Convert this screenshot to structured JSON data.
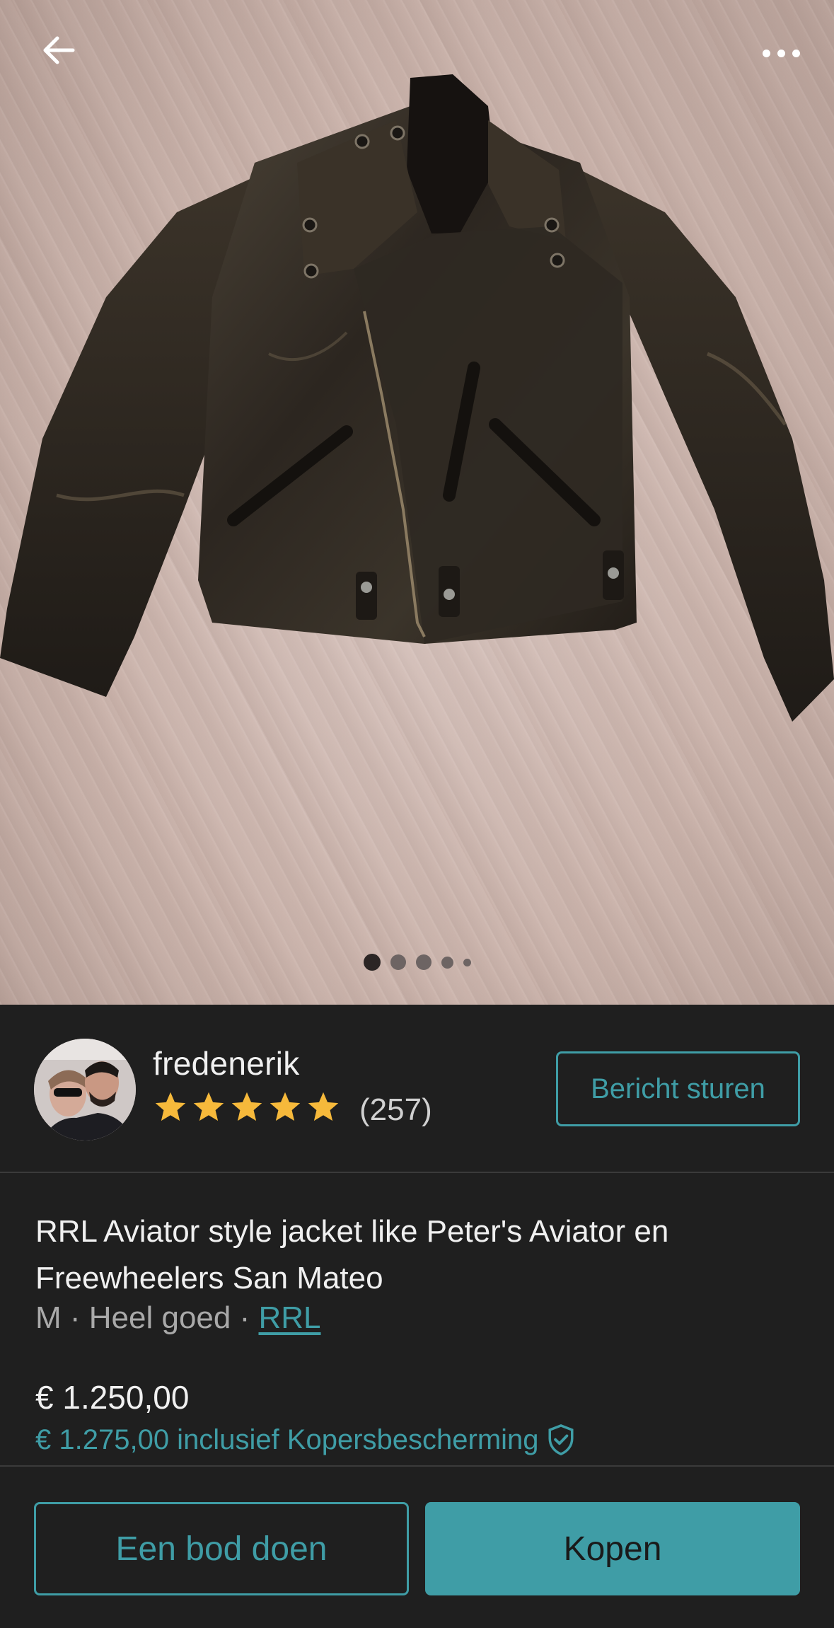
{
  "header": {
    "back_icon": "arrow-left-icon",
    "more_icon": "more-horizontal-icon"
  },
  "gallery": {
    "image_description_icon": "product-photo",
    "page_count": 5,
    "current_page": 1
  },
  "seller": {
    "username": "fredenerik",
    "rating_stars": 5,
    "review_count_label": "(257)",
    "message_button_label": "Bericht sturen"
  },
  "product": {
    "title": "RRL Aviator style jacket like Peter's Aviator en Freewheelers San Mateo",
    "size": "M",
    "separator": " · ",
    "condition": "Heel goed",
    "brand": "RRL",
    "price": "€ 1.250,00",
    "price_with_protection": "€ 1.275,00 inclusief Kopersbescherming",
    "protection_icon": "shield-check-icon"
  },
  "actions": {
    "offer_label": "Een bod doen",
    "buy_label": "Kopen"
  },
  "colors": {
    "accent": "#3f9da6",
    "background": "#1f1f1f",
    "star": "#f6b93b"
  }
}
